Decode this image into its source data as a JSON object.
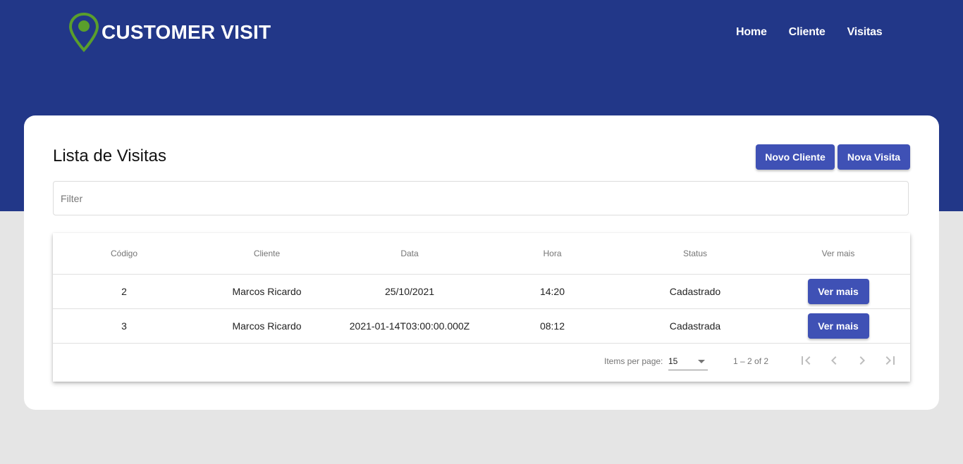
{
  "brand": {
    "name": "CUSTOMER VISIT",
    "logo_icon": "map-pin-icon",
    "logo_color": "#5a9e2c",
    "header_color": "#223788"
  },
  "nav": {
    "items": [
      {
        "label": "Home"
      },
      {
        "label": "Cliente"
      },
      {
        "label": "Visitas"
      }
    ]
  },
  "page": {
    "title": "Lista de Visitas",
    "buttons": {
      "novo_cliente": "Novo Cliente",
      "nova_visita": "Nova Visita"
    },
    "accent_color": "#3f51b5"
  },
  "filter": {
    "placeholder": "Filter",
    "value": ""
  },
  "table": {
    "columns": [
      "Código",
      "Cliente",
      "Data",
      "Hora",
      "Status",
      "Ver mais"
    ],
    "rows": [
      {
        "codigo": "2",
        "cliente": "Marcos Ricardo",
        "data": "25/10/2021",
        "hora": "14:20",
        "status": "Cadastrado",
        "action": "Ver mais"
      },
      {
        "codigo": "3",
        "cliente": "Marcos Ricardo",
        "data": "2021-01-14T03:00:00.000Z",
        "hora": "08:12",
        "status": "Cadastrada",
        "action": "Ver mais"
      }
    ]
  },
  "paginator": {
    "items_per_page_label": "Items per page:",
    "items_per_page_value": "15",
    "range_label": "1 – 2 of 2",
    "icons": {
      "first": "first-page-icon",
      "prev": "chevron-left-icon",
      "next": "chevron-right-icon",
      "last": "last-page-icon"
    }
  }
}
